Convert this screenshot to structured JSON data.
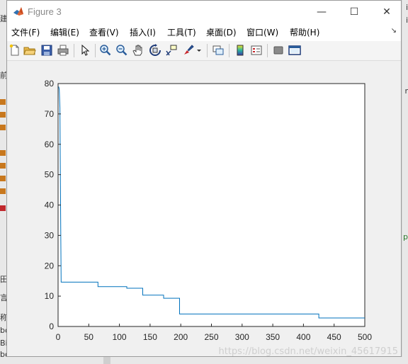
{
  "window": {
    "title": "Figure 3",
    "minimize_glyph": "—",
    "maximize_glyph": "☐",
    "close_glyph": "✕"
  },
  "menu": [
    {
      "label": "文件(F)"
    },
    {
      "label": "编辑(E)"
    },
    {
      "label": "查看(V)"
    },
    {
      "label": "插入(I)"
    },
    {
      "label": "工具(T)"
    },
    {
      "label": "桌面(D)"
    },
    {
      "label": "窗口(W)"
    },
    {
      "label": "帮助(H)"
    }
  ],
  "toolbar_icons": [
    "new-figure-icon",
    "open-file-icon",
    "save-icon",
    "print-icon",
    "edit-plot-arrow-icon",
    "zoom-in-icon",
    "zoom-out-icon",
    "pan-hand-icon",
    "rotate-3d-icon",
    "data-cursor-icon",
    "brush-icon",
    "brush-dropdown-icon",
    "link-plot-icon",
    "insert-colorbar-icon",
    "insert-legend-icon",
    "hide-plot-tools-icon",
    "show-plot-tools-icon"
  ],
  "colors": {
    "line": "#0072bd",
    "axes_bg": "#ffffff",
    "figure_bg": "#f0f0f0"
  },
  "chart_data": {
    "type": "line",
    "title": "",
    "xlabel": "",
    "ylabel": "",
    "xlim": [
      0,
      500
    ],
    "ylim": [
      0,
      80
    ],
    "xticks": [
      0,
      50,
      100,
      150,
      200,
      250,
      300,
      350,
      400,
      450,
      500
    ],
    "yticks": [
      0,
      10,
      20,
      30,
      40,
      50,
      60,
      70,
      80
    ],
    "grid": false,
    "series": [
      {
        "x": [
          1,
          2,
          3,
          4,
          5,
          5,
          65,
          65,
          112,
          112,
          138,
          138,
          172,
          172,
          198,
          198,
          425,
          425,
          500
        ],
        "y": [
          79,
          78,
          72,
          40,
          15,
          14.6,
          14.6,
          13.1,
          13.1,
          12.6,
          12.6,
          10.3,
          10.3,
          9.3,
          9.3,
          4.1,
          4.1,
          2.8,
          2.8
        ]
      }
    ]
  },
  "watermark": "https://blog.csdn.net/weixin_45617915"
}
